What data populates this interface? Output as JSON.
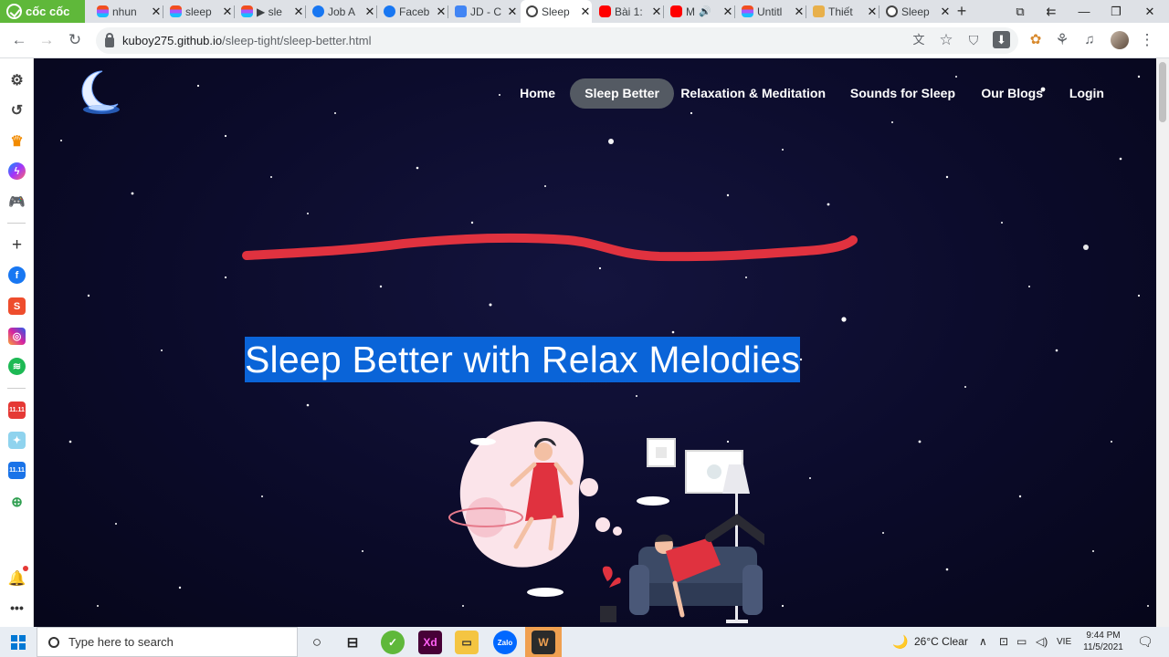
{
  "browser": {
    "brand": "cốc cốc",
    "tabs": [
      {
        "label": "nhun",
        "favicon": "figma-icon"
      },
      {
        "label": "sleep",
        "favicon": "figma-icon"
      },
      {
        "label": "▶ sle",
        "favicon": "figma-icon"
      },
      {
        "label": "Job A",
        "favicon": "facebook-icon"
      },
      {
        "label": "Faceb",
        "favicon": "facebook-icon"
      },
      {
        "label": "JD - C",
        "favicon": "docs-icon"
      },
      {
        "label": "Sleep",
        "favicon": "globe-icon",
        "active": true
      },
      {
        "label": "Bài 1:",
        "favicon": "youtube-icon"
      },
      {
        "label": "M",
        "favicon": "youtube-icon"
      },
      {
        "label": "Untitl",
        "favicon": "figma-icon"
      },
      {
        "label": "Thiết",
        "favicon": "sheet-icon"
      },
      {
        "label": "Sleep",
        "favicon": "globe-icon"
      }
    ],
    "new_tab": "+",
    "address": {
      "host": "kuboy275.github.io",
      "path": "/sleep-tight/sleep-better.html"
    }
  },
  "site": {
    "nav": [
      "Home",
      "Sleep Better",
      "Relaxation & Meditation",
      "Sounds for Sleep",
      "Our Blogs",
      "Login"
    ],
    "active_nav": "Sleep Better",
    "hero_title": "Sleep Better with Relax Melodies"
  },
  "taskbar": {
    "search_placeholder": "Type here to search",
    "weather": "26°C  Clear",
    "language": "VIE",
    "time": "9:44 PM",
    "date": "11/5/2021",
    "apps": [
      "task-view-icon",
      "coccoc-icon",
      "adobe-xd-icon",
      "file-explorer-icon",
      "zalo-icon",
      "audio-app-icon"
    ]
  },
  "colors": {
    "page_bg": "#0b0b2a",
    "hero_highlight": "#0a64d8",
    "scribble": "#e0323f",
    "nav_active_bg": "#545a63",
    "coccoc_green": "#5fb83a"
  }
}
